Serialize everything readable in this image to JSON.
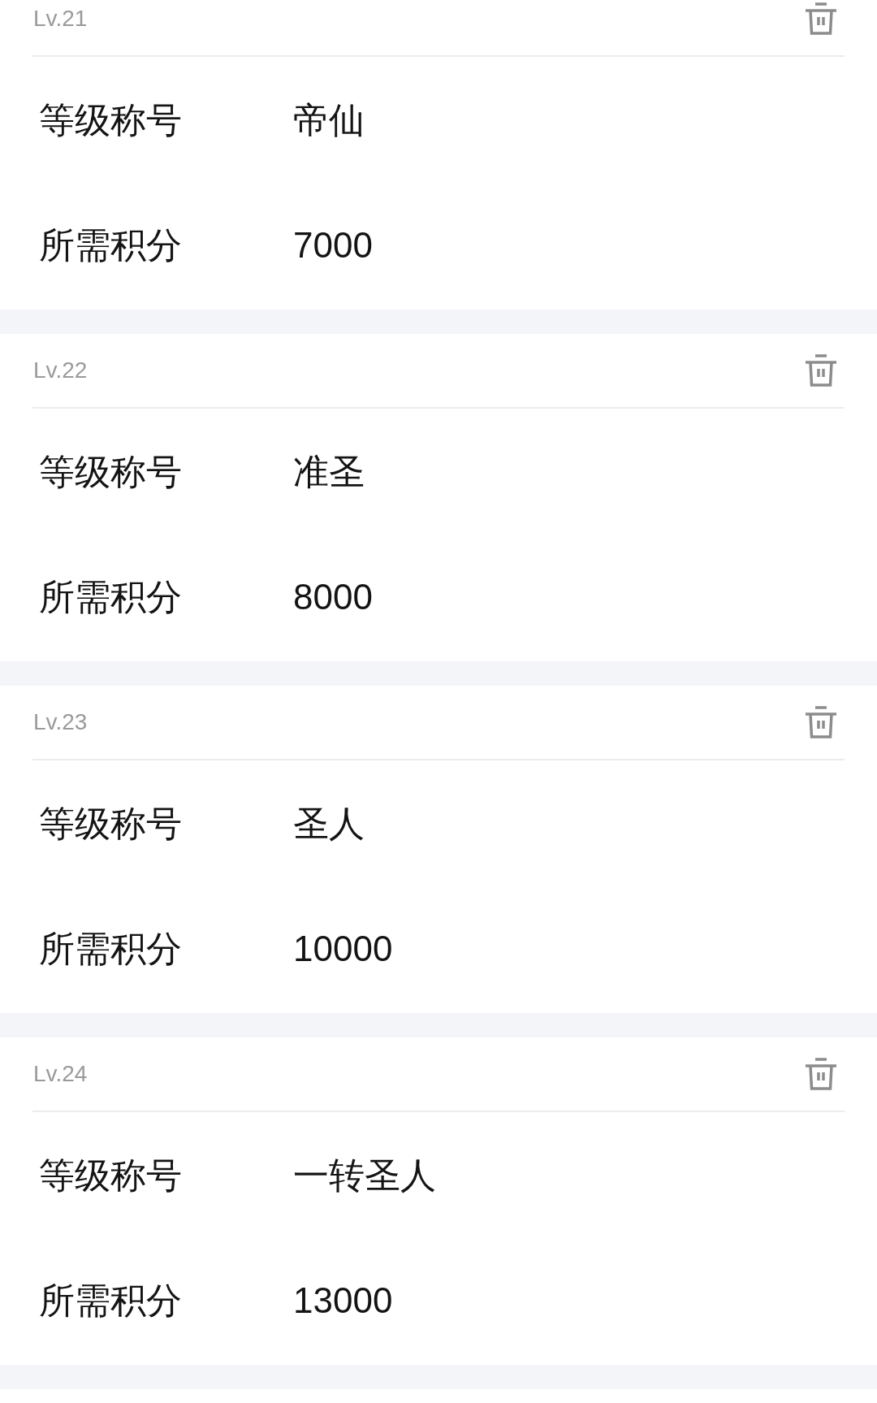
{
  "levels": [
    {
      "level": "Lv.21",
      "fields": [
        {
          "label": "等级称号",
          "value": "帝仙"
        },
        {
          "label": "所需积分",
          "value": "7000"
        }
      ]
    },
    {
      "level": "Lv.22",
      "fields": [
        {
          "label": "等级称号",
          "value": "准圣"
        },
        {
          "label": "所需积分",
          "value": "8000"
        }
      ]
    },
    {
      "level": "Lv.23",
      "fields": [
        {
          "label": "等级称号",
          "value": "圣人"
        },
        {
          "label": "所需积分",
          "value": "10000"
        }
      ]
    },
    {
      "level": "Lv.24",
      "fields": [
        {
          "label": "等级称号",
          "value": "一转圣人"
        },
        {
          "label": "所需积分",
          "value": "13000"
        }
      ]
    }
  ]
}
